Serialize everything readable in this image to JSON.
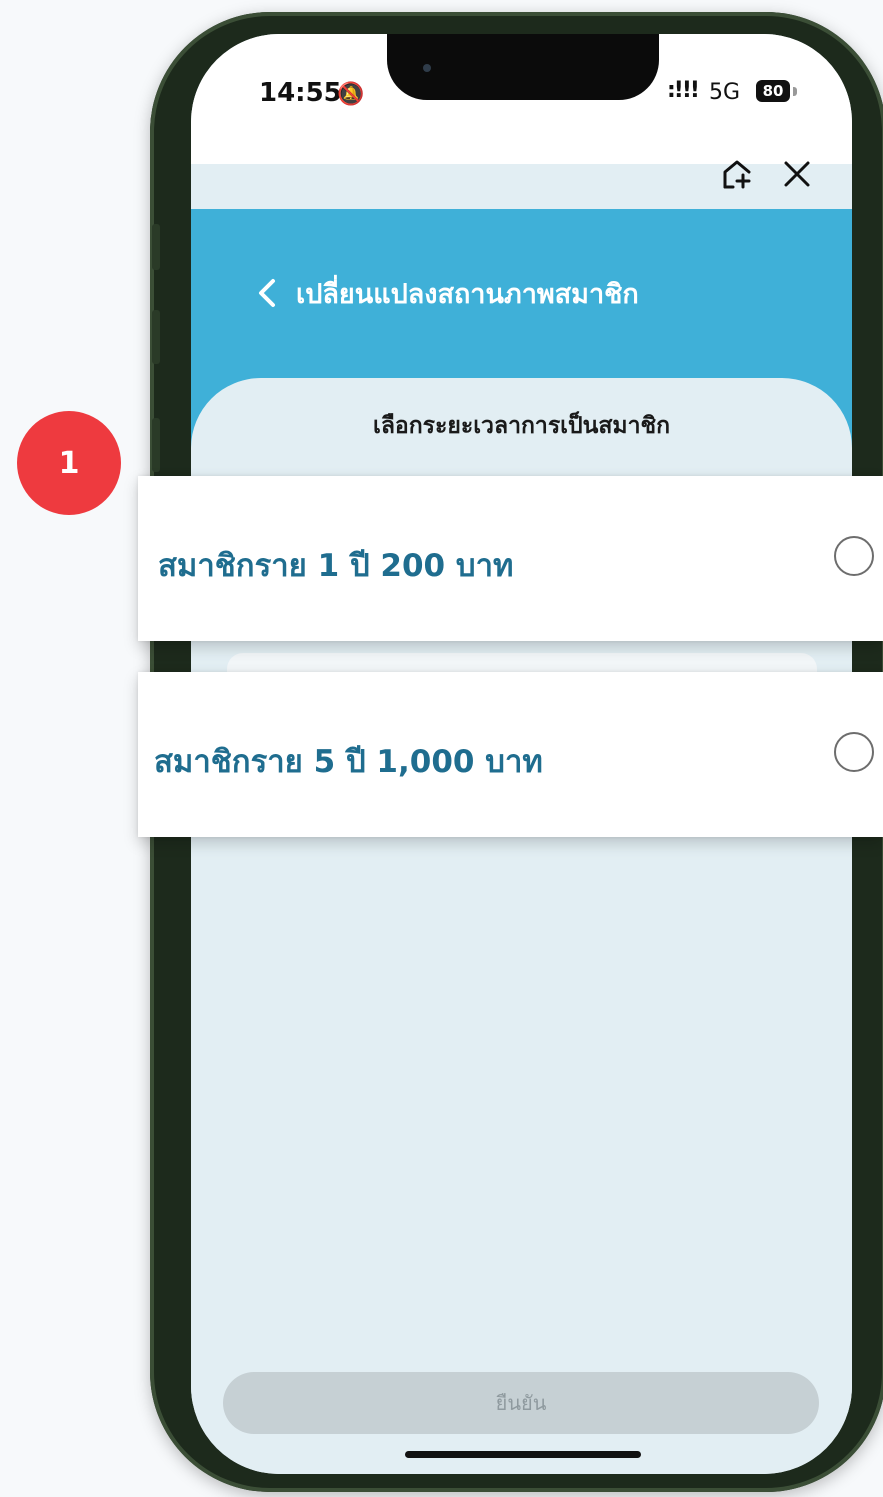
{
  "status_bar": {
    "time": "14:55",
    "network": "5G",
    "battery": "80",
    "signal_icon": "signal-bars-icon",
    "bell_icon": "bell-slash-icon"
  },
  "top_actions": {
    "add_icon": "add-to-home-icon",
    "close_icon": "close-icon"
  },
  "header": {
    "back_icon": "chevron-left-icon",
    "title": "เปลี่ยนแปลงสถานภาพสมาชิก"
  },
  "sheet": {
    "title": "เลือกระยะเวลาการเป็นสมาชิก"
  },
  "options": [
    {
      "label": "สมาชิกราย 1 ปี 200 บาท",
      "selected": false
    },
    {
      "label": "สมาชิกราย 5 ปี 1,000 บาท",
      "selected": false
    }
  ],
  "confirm_button": {
    "label": "ยืนยัน",
    "enabled": false
  },
  "annotation": {
    "step": "1"
  },
  "colors": {
    "header": "#3fb0d8",
    "option_text": "#1f6d8f",
    "badge": "#ee3a3f",
    "sheet_bg": "#e2eef3"
  }
}
